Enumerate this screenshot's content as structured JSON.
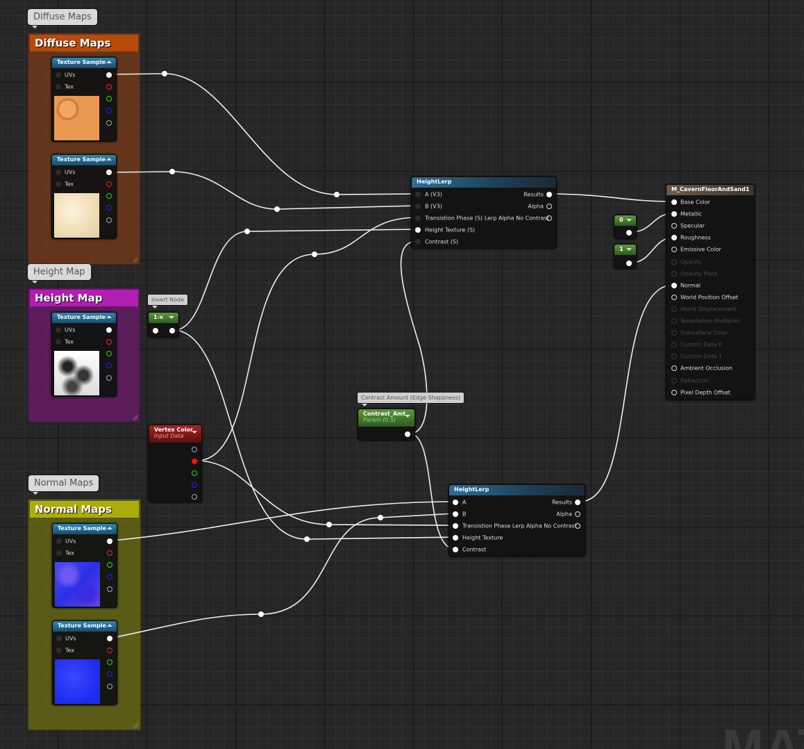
{
  "watermark": "MATERIAL",
  "groups": {
    "diffuse": {
      "bubble": "Diffuse Maps",
      "title": "Diffuse Maps",
      "color": "#b84a0a"
    },
    "height": {
      "bubble": "Height Map",
      "title": "Height Map",
      "color": "#b21db2"
    },
    "normal": {
      "bubble": "Normal Maps",
      "title": "Normal Maps",
      "color": "#acac0c"
    }
  },
  "texture_sample": {
    "title": "Texture Sample",
    "inputs": [
      "UVs",
      "Tex"
    ]
  },
  "invert": {
    "comment": "Invert Node",
    "title": "1-x"
  },
  "vertex_color": {
    "title": "Vertex Color",
    "subtitle": "Input Data"
  },
  "contrast": {
    "comment": "Contrast Amount (Edge Shappness)",
    "title": "Contrast_Amt",
    "subtitle": "Param (0.5)"
  },
  "height_lerp_1": {
    "title": "HeightLerp",
    "inputs": [
      "A (V3)",
      "B (V3)",
      "Transistion Phase (S) Lerp Alpha No Contrast",
      "Height Texture (S)",
      "Contrast (S)"
    ],
    "outputs": [
      "Results",
      "Alpha"
    ]
  },
  "height_lerp_2": {
    "title": "HeightLerp",
    "inputs": [
      "A",
      "B",
      "Transistion Phase Lerp Alpha No Contrast",
      "Height Texture",
      "Contrast"
    ],
    "outputs": [
      "Results",
      "Alpha"
    ]
  },
  "constants": [
    {
      "value": "0"
    },
    {
      "value": "1"
    }
  ],
  "material": {
    "title": "M_CavernFloorAndSand1",
    "pins": [
      {
        "label": "Base Color",
        "enabled": true
      },
      {
        "label": "Metallic",
        "enabled": true
      },
      {
        "label": "Specular",
        "enabled": true
      },
      {
        "label": "Roughness",
        "enabled": true
      },
      {
        "label": "Emissive Color",
        "enabled": true
      },
      {
        "label": "Opacity",
        "enabled": false
      },
      {
        "label": "Opacity Mask",
        "enabled": false
      },
      {
        "label": "Normal",
        "enabled": true
      },
      {
        "label": "World Position Offset",
        "enabled": true
      },
      {
        "label": "World Displacement",
        "enabled": false
      },
      {
        "label": "Tessellation Multiplier",
        "enabled": false
      },
      {
        "label": "Subsurface Color",
        "enabled": false
      },
      {
        "label": "Custom Data 0",
        "enabled": false
      },
      {
        "label": "Custom Data 1",
        "enabled": false
      },
      {
        "label": "Ambient Occlusion",
        "enabled": true
      },
      {
        "label": "Refraction",
        "enabled": false
      },
      {
        "label": "Pixel Depth Offset",
        "enabled": true
      }
    ]
  }
}
